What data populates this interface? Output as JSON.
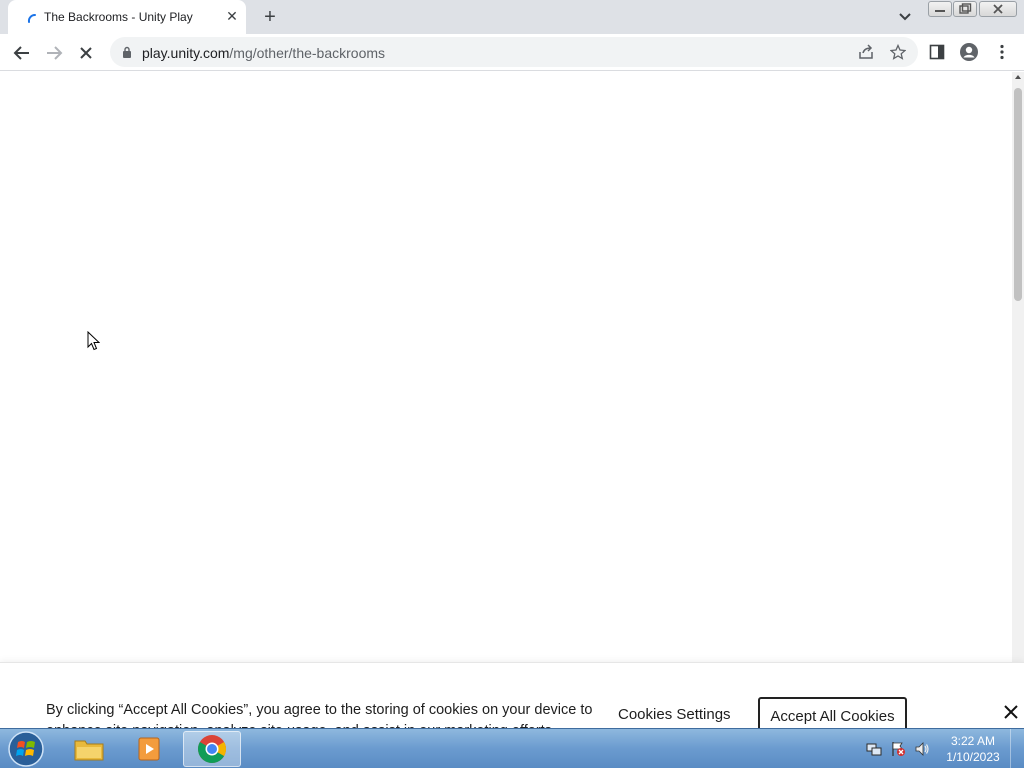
{
  "browser": {
    "tab": {
      "title": "The Backrooms - Unity Play"
    },
    "omnibox": {
      "url_host": "play.unity.com",
      "url_path": "/mg/other/the-backrooms"
    }
  },
  "cookie_banner": {
    "text": "By clicking “Accept All Cookies”, you agree to the storing of cookies on your device to enhance site navigation, analyze site usage, and assist in our marketing efforts.",
    "settings_label": "Cookies Settings",
    "accept_label": "Accept All Cookies"
  },
  "taskbar": {
    "time": "3:22 AM",
    "date": "1/10/2023",
    "apps": [
      "file-explorer",
      "media-player",
      "chrome"
    ]
  },
  "colors": {
    "tabstrip": "#dee1e6",
    "omnibox": "#f1f3f4",
    "taskbar": "#6b9bcf"
  }
}
